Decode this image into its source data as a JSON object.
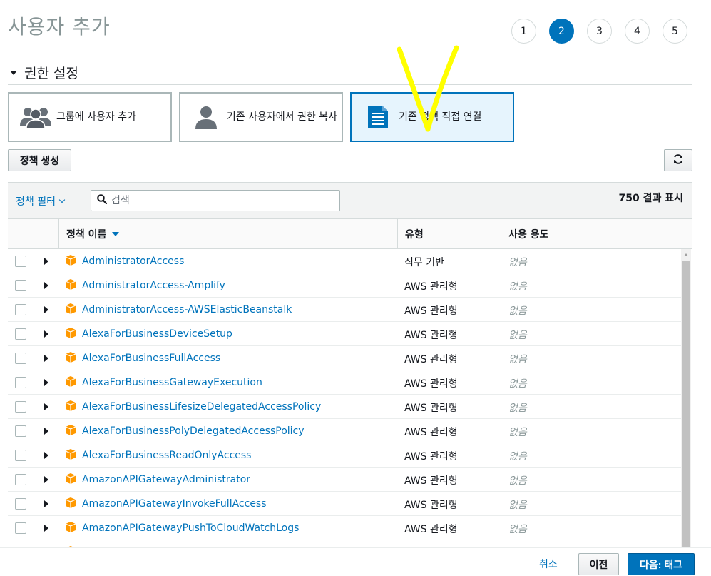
{
  "page": {
    "title": "사용자 추가"
  },
  "steps": [
    "1",
    "2",
    "3",
    "4",
    "5"
  ],
  "active_step": "2",
  "section": {
    "title": "권한 설정"
  },
  "options": [
    {
      "label": "그룹에 사용자 추가",
      "icon": "user-group-icon",
      "selected": false
    },
    {
      "label": "기존 사용자에서 권한 복사",
      "icon": "user-icon",
      "selected": false
    },
    {
      "label": "기존 정책 직접 연결",
      "icon": "document-icon",
      "selected": true
    }
  ],
  "toolbar": {
    "create_policy_label": "정책 생성",
    "refresh_icon": "refresh-icon"
  },
  "filter": {
    "label": "정책 필터",
    "search_placeholder": "검색",
    "result_count": "750 결과 표시"
  },
  "table": {
    "columns": {
      "name": "정책 이름",
      "type": "유형",
      "usage": "사용 용도"
    },
    "rows": [
      {
        "name": "AdministratorAccess",
        "type": "직무 기반",
        "usage": "없음"
      },
      {
        "name": "AdministratorAccess-Amplify",
        "type": "AWS 관리형",
        "usage": "없음"
      },
      {
        "name": "AdministratorAccess-AWSElasticBeanstalk",
        "type": "AWS 관리형",
        "usage": "없음"
      },
      {
        "name": "AlexaForBusinessDeviceSetup",
        "type": "AWS 관리형",
        "usage": "없음"
      },
      {
        "name": "AlexaForBusinessFullAccess",
        "type": "AWS 관리형",
        "usage": "없음"
      },
      {
        "name": "AlexaForBusinessGatewayExecution",
        "type": "AWS 관리형",
        "usage": "없음"
      },
      {
        "name": "AlexaForBusinessLifesizeDelegatedAccessPolicy",
        "type": "AWS 관리형",
        "usage": "없음"
      },
      {
        "name": "AlexaForBusinessPolyDelegatedAccessPolicy",
        "type": "AWS 관리형",
        "usage": "없음"
      },
      {
        "name": "AlexaForBusinessReadOnlyAccess",
        "type": "AWS 관리형",
        "usage": "없음"
      },
      {
        "name": "AmazonAPIGatewayAdministrator",
        "type": "AWS 관리형",
        "usage": "없음"
      },
      {
        "name": "AmazonAPIGatewayInvokeFullAccess",
        "type": "AWS 관리형",
        "usage": "없음"
      },
      {
        "name": "AmazonAPIGatewayPushToCloudWatchLogs",
        "type": "AWS 관리형",
        "usage": "없음"
      },
      {
        "name": "",
        "type": "AWS 관리형",
        "usage": "없음"
      }
    ]
  },
  "footer": {
    "cancel_label": "취소",
    "previous_label": "이전",
    "next_label": "다음: 태그"
  },
  "colors": {
    "accent": "#0073bb",
    "annotation": "#ffff00",
    "package": "#ff9900"
  }
}
